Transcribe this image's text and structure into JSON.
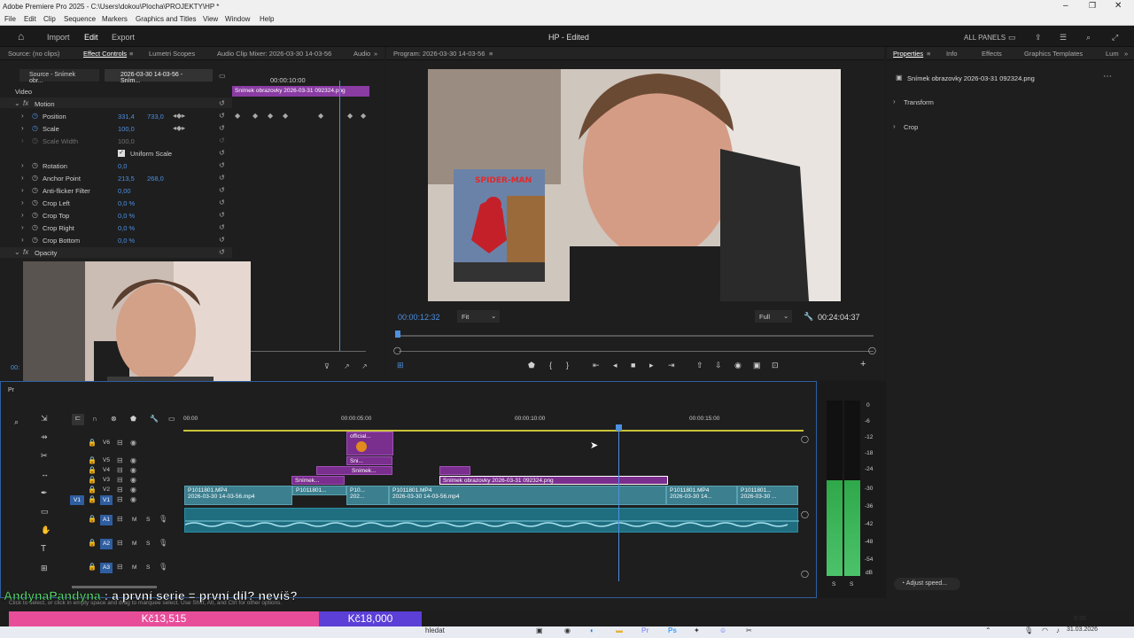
{
  "app": {
    "title": "Adobe Premiere Pro 2025 - C:\\Users\\dokou\\Plocha\\PROJEKTY\\HP *",
    "menu": [
      "File",
      "Edit",
      "Clip",
      "Sequence",
      "Markers",
      "Graphics and Titles",
      "View",
      "Window",
      "Help"
    ],
    "workspace": {
      "import": "Import",
      "edit": "Edit",
      "export": "Export",
      "project": "HP - Edited",
      "panels": "ALL PANELS"
    }
  },
  "source_panel": {
    "tabs": [
      "Source: (no clips)",
      "Effect Controls",
      "Lumetri Scopes",
      "Audio Clip Mixer: 2026-03-30 14-03-56",
      "Audio"
    ],
    "subtabs": [
      "Source - Snímek obr...",
      "2026-03-30 14-03-56 - Sním..."
    ],
    "time": "00:00:10:00",
    "clip_name": "Snímek obrazovky 2026-03-31 092324.png",
    "video_label": "Video",
    "motion": "Motion",
    "properties": [
      {
        "name": "Position",
        "v1": "331,4",
        "v2": "733,0"
      },
      {
        "name": "Scale",
        "v1": "100,0",
        "v2": ""
      },
      {
        "name": "Scale Width",
        "v1": "100,0",
        "v2": ""
      },
      {
        "name": "Rotation",
        "v1": "0,0",
        "v2": ""
      },
      {
        "name": "Anchor Point",
        "v1": "213,5",
        "v2": "268,0"
      },
      {
        "name": "Anti-flicker Filter",
        "v1": "0,00",
        "v2": ""
      },
      {
        "name": "Crop Left",
        "v1": "0,0 %",
        "v2": ""
      },
      {
        "name": "Crop Top",
        "v1": "0,0 %",
        "v2": ""
      },
      {
        "name": "Crop Right",
        "v1": "0,0 %",
        "v2": ""
      },
      {
        "name": "Crop Bottom",
        "v1": "0,0 %",
        "v2": ""
      }
    ],
    "uniform_scale": "Uniform Scale",
    "opacity": "Opacity",
    "ec_time": "00:"
  },
  "program": {
    "title": "Program: 2026-03-30 14-03-56",
    "timecode": "00:00:12:32",
    "fit": "Fit",
    "full": "Full",
    "duration": "00:24:04:37",
    "poster_title": "SPIDER-MAN"
  },
  "properties_panel": {
    "tabs": [
      "Properties",
      "Info",
      "Effects",
      "Graphics Templates",
      "Lum"
    ],
    "file": "Snímek obrazovky 2026-03-31 092324.png",
    "sections": [
      "Transform",
      "Crop"
    ],
    "adjust_speed": "Adjust speed..."
  },
  "timeline": {
    "project_label": "Pr",
    "ruler": [
      "00:00",
      "00:00:05:00",
      "00:00:10:00",
      "00:00:15:00"
    ],
    "video_tracks": [
      "V6",
      "V5",
      "V4",
      "V3",
      "V2",
      "V1"
    ],
    "audio_tracks": [
      "A1",
      "A2",
      "A3"
    ],
    "clips": {
      "v6": "official...",
      "v5": "Sni...",
      "v4": "Snímek...",
      "v3": "Snímek...",
      "v3_long": "Snímek obrazovky 2026-03-31 092324.png",
      "v2": [
        "P1011801.MP4",
        "P1011801...",
        "P10...",
        "P1011801.MP4",
        "P1011801.MP4",
        "P1011801..."
      ],
      "v1": [
        "2026-03-30 14-03-56.mp4",
        "202...",
        "2026-03-30 14-03-56.mp4",
        "2026-03-30 14...",
        "2026-03-30 ..."
      ]
    },
    "meter_scale": [
      "0",
      "-6",
      "-12",
      "-18",
      "-24",
      "-30",
      "-36",
      "-42",
      "-48",
      "-54",
      "dB"
    ],
    "meter_s": [
      "S",
      "S"
    ]
  },
  "overlay": {
    "chat_user": "AndynaPandyna",
    "chat_msg": ": a první serie = první díl? nevíš?",
    "status": "Click to select, or click in empty space and drag to marquee select. Use Shift, Alt, and Ctrl for other options.",
    "donation1": "Kč13,515",
    "donation2": "Kč18,000"
  },
  "taskbar": {
    "search": "hledat",
    "time": "9:35",
    "date": "31.03.2026"
  },
  "colors": {
    "accent": "#4d8fe0",
    "clip_video": "#3c7f8f",
    "clip_graphic": "#7a2e8e",
    "donation_pink": "#e84d9a",
    "donation_purple": "#5b3fd6"
  }
}
